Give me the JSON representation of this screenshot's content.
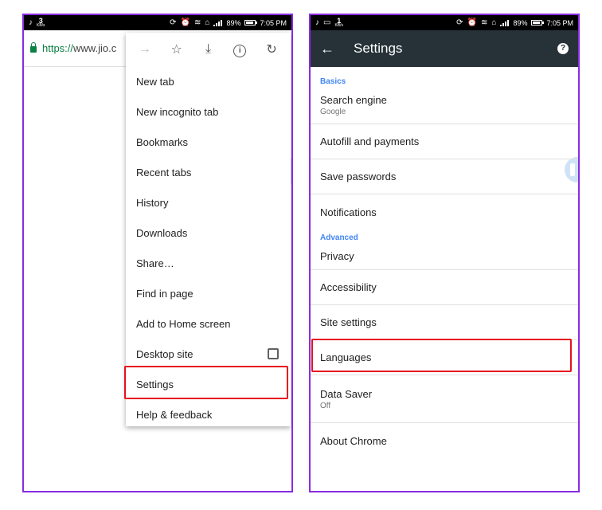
{
  "status_left": {
    "speed": "3",
    "speed_unit": "KB/s",
    "battery": "89%",
    "time": "7:05 PM"
  },
  "status_right": {
    "speed": "1",
    "speed_unit": "KB/s",
    "battery": "89%",
    "time": "7:05 PM"
  },
  "browser": {
    "url_scheme": "https://",
    "url_host": "www.jio.c"
  },
  "menu": {
    "icons": [
      "forward-arrow-icon",
      "star-icon",
      "download-icon",
      "info-icon",
      "refresh-icon"
    ],
    "items": [
      "New tab",
      "New incognito tab",
      "Bookmarks",
      "Recent tabs",
      "History",
      "Downloads",
      "Share…",
      "Find in page",
      "Add to Home screen",
      "Desktop site",
      "Settings",
      "Help & feedback"
    ],
    "highlighted": "Settings"
  },
  "settings": {
    "title": "Settings",
    "sections": {
      "basics": "Basics",
      "advanced": "Advanced"
    },
    "rows": {
      "search_engine": {
        "title": "Search engine",
        "sub": "Google"
      },
      "autofill": {
        "title": "Autofill and payments"
      },
      "passwords": {
        "title": "Save passwords"
      },
      "notifications": {
        "title": "Notifications"
      },
      "privacy": {
        "title": "Privacy"
      },
      "accessibility": {
        "title": "Accessibility"
      },
      "site_settings": {
        "title": "Site settings"
      },
      "languages": {
        "title": "Languages"
      },
      "data_saver": {
        "title": "Data Saver",
        "sub": "Off"
      },
      "about": {
        "title": "About Chrome"
      }
    },
    "highlighted": "Site settings"
  },
  "colors": {
    "frame": "#8a2be2",
    "highlight": "#e8111e",
    "appbar": "#263238",
    "section_header": "#4285f4",
    "secure_green": "#0b8043"
  }
}
